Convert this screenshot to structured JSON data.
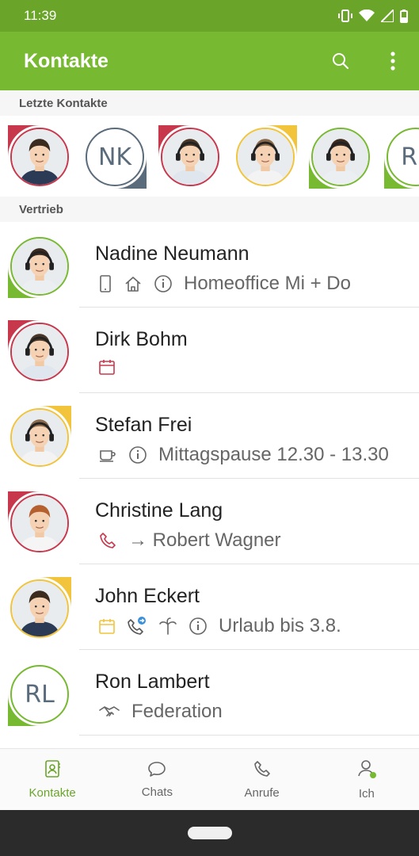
{
  "colors": {
    "green": "#78b932",
    "dark_green": "#6aa52a",
    "red": "#c8384d",
    "yellow": "#f1c43c",
    "grey": "#5a6b7b",
    "accent_blue": "#3a8fd8"
  },
  "status_bar": {
    "time": "11:39",
    "icons": [
      "vibrate-icon",
      "wifi-icon",
      "signal-icon",
      "battery-icon"
    ]
  },
  "app_bar": {
    "title": "Kontakte",
    "search_icon": "search-icon",
    "menu_icon": "more-vert-icon"
  },
  "recent": {
    "header": "Letzte Kontakte",
    "contacts": [
      {
        "initials": "",
        "status": "red",
        "photo": true
      },
      {
        "initials": "NK",
        "status": "grey",
        "photo": false
      },
      {
        "initials": "",
        "status": "red",
        "photo": true
      },
      {
        "initials": "",
        "status": "yellow",
        "photo": true
      },
      {
        "initials": "",
        "status": "green",
        "photo": true
      },
      {
        "initials": "RL",
        "status": "green",
        "photo": false
      }
    ]
  },
  "group": {
    "header": "Vertrieb",
    "contacts": [
      {
        "name": "Nadine Neumann",
        "status": "green",
        "icons": [
          "mobile-icon",
          "home-icon",
          "info-icon"
        ],
        "text": "Homeoffice Mi + Do"
      },
      {
        "name": "Dirk Bohm",
        "status": "red",
        "icons": [
          "calendar-icon"
        ],
        "text": ""
      },
      {
        "name": "Stefan Frei",
        "status": "yellow",
        "icons": [
          "coffee-icon",
          "info-icon"
        ],
        "text": "Mittagspause 12.30 - 13.30"
      },
      {
        "name": "Christine Lang",
        "status": "red",
        "icons": [
          "phone-icon"
        ],
        "text": "→ Robert Wagner"
      },
      {
        "name": "John Eckert",
        "status": "yellow",
        "icons": [
          "calendar-icon",
          "phone-forward-icon",
          "palm-icon",
          "info-icon"
        ],
        "text": "Urlaub bis 3.8."
      },
      {
        "name": "Ron Lambert",
        "status": "green",
        "initials": "RL",
        "icons": [
          "handshake-icon"
        ],
        "text": "Federation"
      }
    ]
  },
  "bottom_nav": {
    "items": [
      {
        "label": "Kontakte",
        "icon": "contacts-icon",
        "active": true
      },
      {
        "label": "Chats",
        "icon": "chat-icon",
        "active": false
      },
      {
        "label": "Anrufe",
        "icon": "phone-icon",
        "active": false
      },
      {
        "label": "Ich",
        "icon": "user-icon",
        "active": false
      }
    ]
  }
}
